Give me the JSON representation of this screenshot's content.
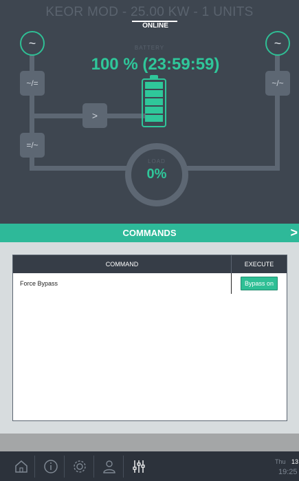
{
  "header": {
    "title": "KEOR MOD - 25.00 KW - 1 UNITS",
    "status": "ONLINE"
  },
  "mimic": {
    "source_icon": "~",
    "rectifier_label": "~/=",
    "inverter_label": "=/~",
    "bypass_label": "~/~",
    "switch_label": ">",
    "battery_label": "BATTERY",
    "battery_value": "100 % (23:59:59)",
    "battery_level_pct": 100,
    "load_label": "LOAD",
    "load_value": "0%"
  },
  "commands": {
    "title": "COMMANDS",
    "arrow": ">",
    "columns": [
      "COMMAND",
      "EXECUTE"
    ],
    "rows": [
      {
        "command": "Force Bypass",
        "action": "Bypass on"
      }
    ]
  },
  "nav": {
    "items": [
      "home-icon",
      "info-icon",
      "gear-icon",
      "user-icon",
      "sliders-icon"
    ],
    "day": "Thu",
    "date": "13",
    "time": "19:25"
  },
  "colors": {
    "accent": "#2fbf95",
    "panel": "#3e4650",
    "nav": "#2c323b"
  }
}
